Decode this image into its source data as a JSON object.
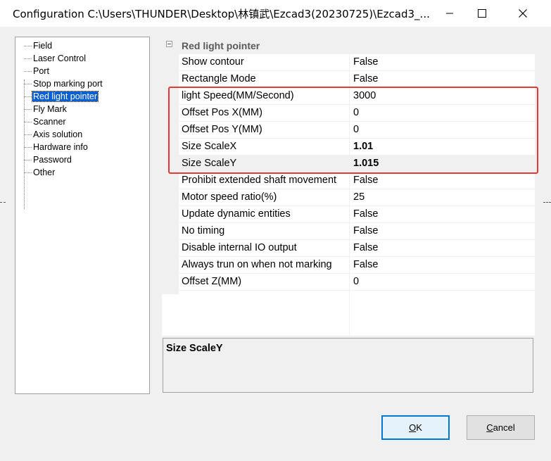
{
  "window": {
    "title": "Configuration C:\\Users\\THUNDER\\Desktop\\林镇武\\Ezcad3(20230725)\\Ezcad3_..."
  },
  "tree": {
    "items": [
      {
        "label": "Field",
        "selected": false
      },
      {
        "label": "Laser Control",
        "selected": false
      },
      {
        "label": "Port",
        "selected": false
      },
      {
        "label": "Stop marking port",
        "selected": false
      },
      {
        "label": "Red light pointer",
        "selected": true
      },
      {
        "label": "Fly Mark",
        "selected": false
      },
      {
        "label": "Scanner",
        "selected": false
      },
      {
        "label": "Axis solution",
        "selected": false
      },
      {
        "label": "Hardware info",
        "selected": false
      },
      {
        "label": "Password",
        "selected": false
      },
      {
        "label": "Other",
        "selected": false
      }
    ]
  },
  "grid": {
    "category": "Red light pointer",
    "rows": [
      {
        "name": "Show contour",
        "value": "False"
      },
      {
        "name": "Rectangle Mode",
        "value": "False"
      },
      {
        "name": "light Speed(MM/Second)",
        "value": "3000"
      },
      {
        "name": "Offset Pos X(MM)",
        "value": "0"
      },
      {
        "name": "Offset Pos Y(MM)",
        "value": "0"
      },
      {
        "name": "Size ScaleX",
        "value": "1.01"
      },
      {
        "name": "Size ScaleY",
        "value": "1.015"
      },
      {
        "name": "Prohibit extended shaft movement",
        "value": "False"
      },
      {
        "name": "Motor speed ratio(%)",
        "value": "25"
      },
      {
        "name": "Update dynamic entities",
        "value": "False"
      },
      {
        "name": "No timing",
        "value": "False"
      },
      {
        "name": "Disable internal IO output",
        "value": "False"
      },
      {
        "name": "Always trun on when not marking",
        "value": "False"
      },
      {
        "name": "Offset Z(MM)",
        "value": "0"
      }
    ]
  },
  "description": {
    "title": "Size ScaleY"
  },
  "buttons": {
    "ok": {
      "accel": "O",
      "rest": "K"
    },
    "cancel": {
      "accel": "C",
      "rest": "ancel"
    }
  },
  "colors": {
    "selection": "#0a5fd1",
    "highlight_box": "#e53935",
    "ok_border": "#0078d7"
  },
  "icons": [
    "minimize-icon",
    "maximize-icon",
    "close-icon"
  ]
}
